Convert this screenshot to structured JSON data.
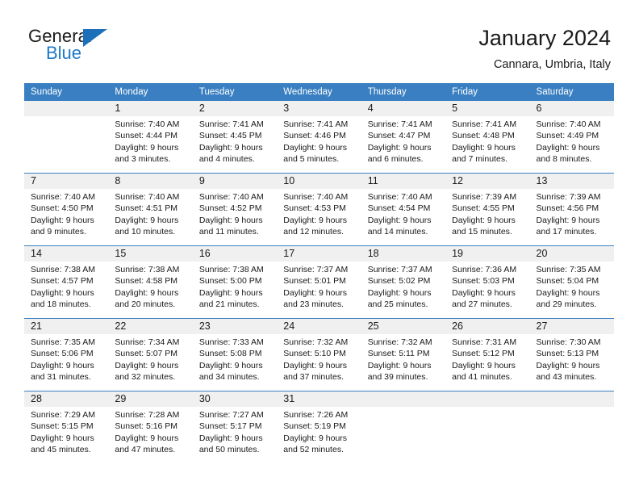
{
  "brand": {
    "name_part1": "General",
    "name_part2": "Blue",
    "accent_color": "#1e78c8",
    "triangle_color": "#1e6fba"
  },
  "header": {
    "title": "January 2024",
    "subtitle": "Cannara, Umbria, Italy"
  },
  "theme": {
    "header_bar_color": "#3a7fc1",
    "daynum_band_color": "#f0f0f0",
    "text_color": "#1a1a1a"
  },
  "weekdays": [
    "Sunday",
    "Monday",
    "Tuesday",
    "Wednesday",
    "Thursday",
    "Friday",
    "Saturday"
  ],
  "weeks": [
    {
      "days": [
        {
          "num": "",
          "lines": []
        },
        {
          "num": "1",
          "lines": [
            "Sunrise: 7:40 AM",
            "Sunset: 4:44 PM",
            "Daylight: 9 hours",
            "and 3 minutes."
          ]
        },
        {
          "num": "2",
          "lines": [
            "Sunrise: 7:41 AM",
            "Sunset: 4:45 PM",
            "Daylight: 9 hours",
            "and 4 minutes."
          ]
        },
        {
          "num": "3",
          "lines": [
            "Sunrise: 7:41 AM",
            "Sunset: 4:46 PM",
            "Daylight: 9 hours",
            "and 5 minutes."
          ]
        },
        {
          "num": "4",
          "lines": [
            "Sunrise: 7:41 AM",
            "Sunset: 4:47 PM",
            "Daylight: 9 hours",
            "and 6 minutes."
          ]
        },
        {
          "num": "5",
          "lines": [
            "Sunrise: 7:41 AM",
            "Sunset: 4:48 PM",
            "Daylight: 9 hours",
            "and 7 minutes."
          ]
        },
        {
          "num": "6",
          "lines": [
            "Sunrise: 7:40 AM",
            "Sunset: 4:49 PM",
            "Daylight: 9 hours",
            "and 8 minutes."
          ]
        }
      ]
    },
    {
      "days": [
        {
          "num": "7",
          "lines": [
            "Sunrise: 7:40 AM",
            "Sunset: 4:50 PM",
            "Daylight: 9 hours",
            "and 9 minutes."
          ]
        },
        {
          "num": "8",
          "lines": [
            "Sunrise: 7:40 AM",
            "Sunset: 4:51 PM",
            "Daylight: 9 hours",
            "and 10 minutes."
          ]
        },
        {
          "num": "9",
          "lines": [
            "Sunrise: 7:40 AM",
            "Sunset: 4:52 PM",
            "Daylight: 9 hours",
            "and 11 minutes."
          ]
        },
        {
          "num": "10",
          "lines": [
            "Sunrise: 7:40 AM",
            "Sunset: 4:53 PM",
            "Daylight: 9 hours",
            "and 12 minutes."
          ]
        },
        {
          "num": "11",
          "lines": [
            "Sunrise: 7:40 AM",
            "Sunset: 4:54 PM",
            "Daylight: 9 hours",
            "and 14 minutes."
          ]
        },
        {
          "num": "12",
          "lines": [
            "Sunrise: 7:39 AM",
            "Sunset: 4:55 PM",
            "Daylight: 9 hours",
            "and 15 minutes."
          ]
        },
        {
          "num": "13",
          "lines": [
            "Sunrise: 7:39 AM",
            "Sunset: 4:56 PM",
            "Daylight: 9 hours",
            "and 17 minutes."
          ]
        }
      ]
    },
    {
      "days": [
        {
          "num": "14",
          "lines": [
            "Sunrise: 7:38 AM",
            "Sunset: 4:57 PM",
            "Daylight: 9 hours",
            "and 18 minutes."
          ]
        },
        {
          "num": "15",
          "lines": [
            "Sunrise: 7:38 AM",
            "Sunset: 4:58 PM",
            "Daylight: 9 hours",
            "and 20 minutes."
          ]
        },
        {
          "num": "16",
          "lines": [
            "Sunrise: 7:38 AM",
            "Sunset: 5:00 PM",
            "Daylight: 9 hours",
            "and 21 minutes."
          ]
        },
        {
          "num": "17",
          "lines": [
            "Sunrise: 7:37 AM",
            "Sunset: 5:01 PM",
            "Daylight: 9 hours",
            "and 23 minutes."
          ]
        },
        {
          "num": "18",
          "lines": [
            "Sunrise: 7:37 AM",
            "Sunset: 5:02 PM",
            "Daylight: 9 hours",
            "and 25 minutes."
          ]
        },
        {
          "num": "19",
          "lines": [
            "Sunrise: 7:36 AM",
            "Sunset: 5:03 PM",
            "Daylight: 9 hours",
            "and 27 minutes."
          ]
        },
        {
          "num": "20",
          "lines": [
            "Sunrise: 7:35 AM",
            "Sunset: 5:04 PM",
            "Daylight: 9 hours",
            "and 29 minutes."
          ]
        }
      ]
    },
    {
      "days": [
        {
          "num": "21",
          "lines": [
            "Sunrise: 7:35 AM",
            "Sunset: 5:06 PM",
            "Daylight: 9 hours",
            "and 31 minutes."
          ]
        },
        {
          "num": "22",
          "lines": [
            "Sunrise: 7:34 AM",
            "Sunset: 5:07 PM",
            "Daylight: 9 hours",
            "and 32 minutes."
          ]
        },
        {
          "num": "23",
          "lines": [
            "Sunrise: 7:33 AM",
            "Sunset: 5:08 PM",
            "Daylight: 9 hours",
            "and 34 minutes."
          ]
        },
        {
          "num": "24",
          "lines": [
            "Sunrise: 7:32 AM",
            "Sunset: 5:10 PM",
            "Daylight: 9 hours",
            "and 37 minutes."
          ]
        },
        {
          "num": "25",
          "lines": [
            "Sunrise: 7:32 AM",
            "Sunset: 5:11 PM",
            "Daylight: 9 hours",
            "and 39 minutes."
          ]
        },
        {
          "num": "26",
          "lines": [
            "Sunrise: 7:31 AM",
            "Sunset: 5:12 PM",
            "Daylight: 9 hours",
            "and 41 minutes."
          ]
        },
        {
          "num": "27",
          "lines": [
            "Sunrise: 7:30 AM",
            "Sunset: 5:13 PM",
            "Daylight: 9 hours",
            "and 43 minutes."
          ]
        }
      ]
    },
    {
      "days": [
        {
          "num": "28",
          "lines": [
            "Sunrise: 7:29 AM",
            "Sunset: 5:15 PM",
            "Daylight: 9 hours",
            "and 45 minutes."
          ]
        },
        {
          "num": "29",
          "lines": [
            "Sunrise: 7:28 AM",
            "Sunset: 5:16 PM",
            "Daylight: 9 hours",
            "and 47 minutes."
          ]
        },
        {
          "num": "30",
          "lines": [
            "Sunrise: 7:27 AM",
            "Sunset: 5:17 PM",
            "Daylight: 9 hours",
            "and 50 minutes."
          ]
        },
        {
          "num": "31",
          "lines": [
            "Sunrise: 7:26 AM",
            "Sunset: 5:19 PM",
            "Daylight: 9 hours",
            "and 52 minutes."
          ]
        },
        {
          "num": "",
          "lines": []
        },
        {
          "num": "",
          "lines": []
        },
        {
          "num": "",
          "lines": []
        }
      ]
    }
  ]
}
